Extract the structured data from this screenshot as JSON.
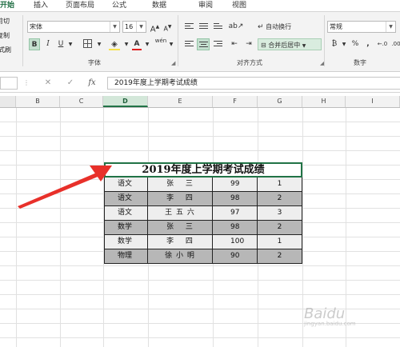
{
  "tabs": [
    {
      "label": "开始",
      "active": true
    },
    {
      "label": "插入"
    },
    {
      "label": "页面布局"
    },
    {
      "label": "公式"
    },
    {
      "label": "数据"
    },
    {
      "label": "审阅"
    },
    {
      "label": "视图"
    }
  ],
  "clipboard": {
    "cut": "剪切",
    "copy": "复制",
    "format_painter": "格式刷"
  },
  "font": {
    "family": "宋体",
    "size": "16",
    "group_label": "字体",
    "grow": "A",
    "shrink": "A",
    "bold": "B",
    "italic": "I",
    "underline": "U",
    "font_color": "A",
    "phonetic": "wén"
  },
  "alignment": {
    "wrap_text": "自动换行",
    "merge_center": "合并后居中",
    "group_label": "对齐方式"
  },
  "number": {
    "format": "常规",
    "percent": "%",
    "comma": ",",
    "group_label": "数字"
  },
  "formula_bar": {
    "fx": "fx",
    "content": "2019年度上学期考试成绩",
    "cancel": "✕",
    "enter": "✓"
  },
  "columns": [
    "B",
    "C",
    "D",
    "E",
    "F",
    "G",
    "H",
    "I"
  ],
  "selected_column": "D",
  "table": {
    "title": "2019年度上学期考试成绩",
    "rows": [
      {
        "subject": "语文",
        "name": "张　 三",
        "score": "99",
        "rank": "1",
        "shade": "light"
      },
      {
        "subject": "语文",
        "name": "李　 四",
        "score": "98",
        "rank": "2",
        "shade": "dark"
      },
      {
        "subject": "语文",
        "name": "王 五 六",
        "score": "97",
        "rank": "3",
        "shade": "light"
      },
      {
        "subject": "数学",
        "name": "张　 三",
        "score": "98",
        "rank": "2",
        "shade": "dark"
      },
      {
        "subject": "数学",
        "name": "李　 四",
        "score": "100",
        "rank": "1",
        "shade": "light"
      },
      {
        "subject": "物理",
        "name": "徐 小 明",
        "score": "90",
        "rank": "2",
        "shade": "dark"
      }
    ]
  },
  "watermark": {
    "brand": "Baidu",
    "sub": "jingyan.baidu.com"
  },
  "colors": {
    "accent": "#217346",
    "arrow": "#e8302a"
  }
}
